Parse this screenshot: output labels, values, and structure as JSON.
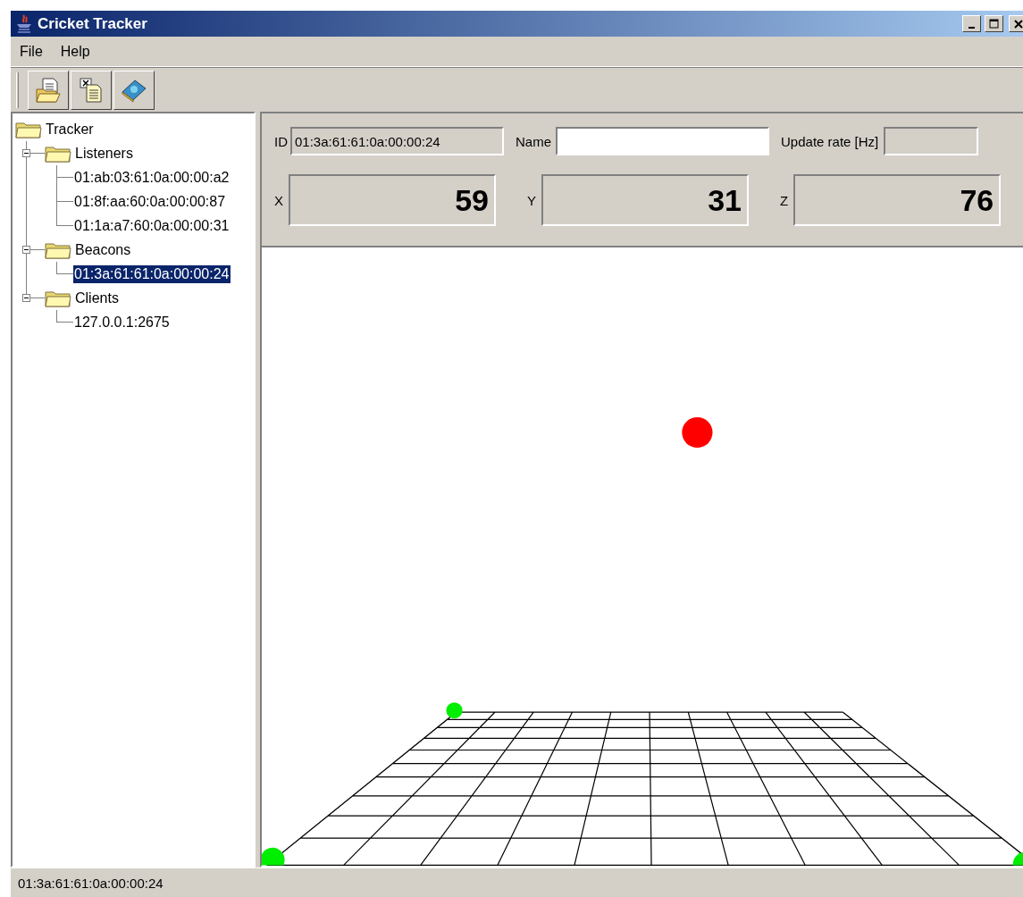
{
  "window": {
    "title": "Cricket Tracker"
  },
  "menu": [
    "File",
    "Help"
  ],
  "tree": {
    "label": "Tracker",
    "children": [
      {
        "label": "Listeners",
        "expanded": true,
        "children": [
          {
            "label": "01:ab:03:61:0a:00:00:a2",
            "selected": false
          },
          {
            "label": "01:8f:aa:60:0a:00:00:87",
            "selected": false
          },
          {
            "label": "01:1a:a7:60:0a:00:00:31",
            "selected": false
          }
        ]
      },
      {
        "label": "Beacons",
        "expanded": true,
        "children": [
          {
            "label": "01:3a:61:61:0a:00:00:24",
            "selected": true
          }
        ]
      },
      {
        "label": "Clients",
        "expanded": true,
        "children": [
          {
            "label": "127.0.0.1:2675",
            "selected": false
          }
        ]
      }
    ]
  },
  "details": {
    "id_label": "ID",
    "id_value": "01:3a:61:61:0a:00:00:24",
    "name_label": "Name",
    "rate_label": "Update rate [Hz]",
    "coordinates": [
      {
        "axis": "X",
        "value": "59"
      },
      {
        "axis": "Y",
        "value": "31"
      },
      {
        "axis": "Z",
        "value": "76"
      }
    ]
  },
  "status_bar": "01:3a:61:61:0a:00:00:24"
}
